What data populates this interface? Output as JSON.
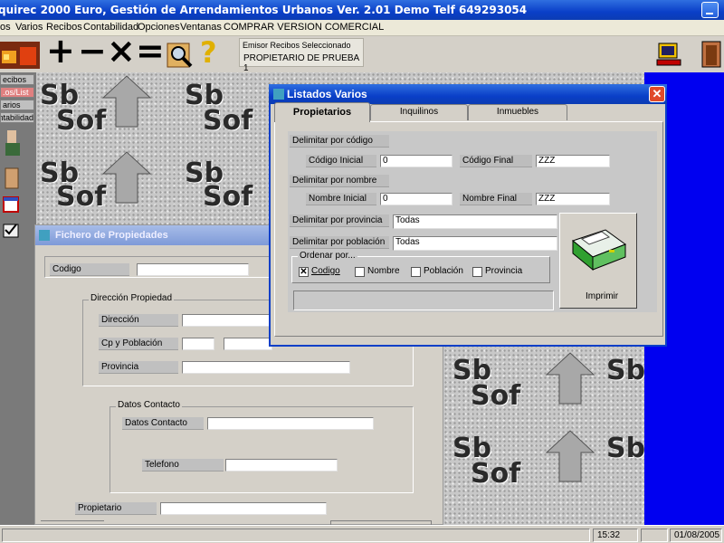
{
  "window": {
    "title": "quirec 2000 Euro, Gestión de Arrendamientos Urbanos Ver. 2.01 Demo Telf 649293054"
  },
  "menu": [
    "os",
    "Varios",
    "Recibos",
    "Contabilidad",
    "Opciones",
    "Ventanas",
    "COMPRAR VERSION COMERCIAL"
  ],
  "toolbar": {
    "symbols": [
      "+",
      "−",
      "×",
      "="
    ],
    "help_symbol": "?",
    "emisor_label": "Emisor Recibos Seleccionado",
    "emisor_value": "PROPIETARIO DE PRUEBA 1"
  },
  "left_panel": {
    "tabs": [
      "ecibos",
      "os/List.",
      "arios",
      "ntabilidad"
    ],
    "selected_index": 1
  },
  "background_logo": {
    "line1": "Sb",
    "line2": "Sof"
  },
  "fichero": {
    "title": "Fichero de Propiedades",
    "codigo_label": "Codigo",
    "direccion_group": "Dirección Propiedad",
    "direccion_label": "Dirección",
    "cp_label": "Cp y Población",
    "provincia_label": "Provincia",
    "contacto_group": "Datos Contacto",
    "contacto_label": "Datos Contacto",
    "telefono_label": "Telefono",
    "propietario_label": "Propietario"
  },
  "listados": {
    "title": "Listados Varios",
    "close": "✕",
    "tabs": [
      "Propietarios",
      "Inquilinos",
      "Inmuebles"
    ],
    "active_tab": 0,
    "delimitar_codigo": "Delimitar por código",
    "codigo_inicial_label": "Código Inicial",
    "codigo_inicial_value": "0",
    "codigo_final_label": "Código Final",
    "codigo_final_value": "ZZZ",
    "delimitar_nombre": "Delimitar por nombre",
    "nombre_inicial_label": "Nombre Inicial",
    "nombre_inicial_value": "0",
    "nombre_final_label": "Nombre Final",
    "nombre_final_value": "ZZZ",
    "provincia_label": "Delimitar por provincia",
    "provincia_value": "Todas",
    "poblacion_label": "Delimitar por población",
    "poblacion_value": "Todas",
    "ordenar_label": "Ordenar por...",
    "order_options": [
      {
        "label": "Codigo",
        "checked": true
      },
      {
        "label": "Nombre",
        "checked": false
      },
      {
        "label": "Población",
        "checked": false
      },
      {
        "label": "Provincia",
        "checked": false
      }
    ],
    "imprimir_label": "Imprimir"
  },
  "status": {
    "time": "15:32",
    "date": "01/08/2005"
  },
  "colors": {
    "title_blue": "#0a3fc8",
    "desktop_blue": "#0000f0",
    "close_red": "#e04a2a",
    "selected_tab": "#e08080"
  }
}
